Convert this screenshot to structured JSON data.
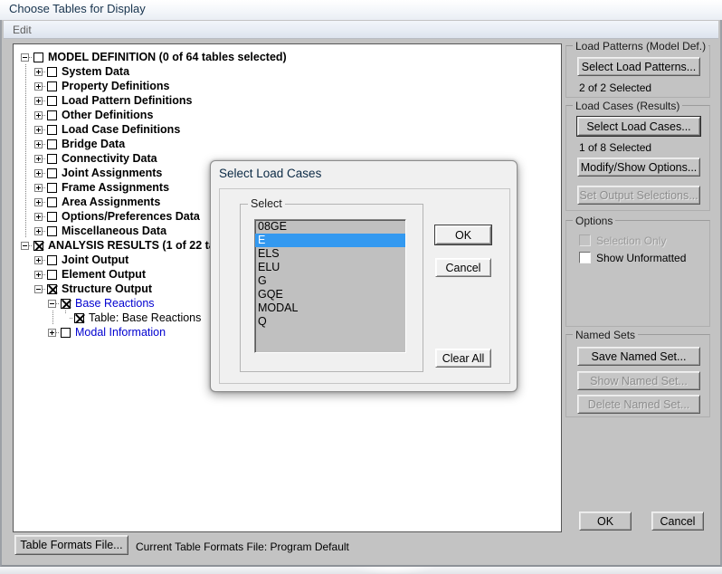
{
  "window": {
    "title": "Choose Tables for Display",
    "menu": [
      "Edit"
    ]
  },
  "tree": {
    "nodes": [
      {
        "label": "MODEL DEFINITION  (0 of 64 tables selected)",
        "depth": 0,
        "expander": "minus",
        "checked": false,
        "bold": true,
        "blue": false
      },
      {
        "label": "System Data",
        "depth": 1,
        "expander": "plus",
        "checked": false,
        "bold": true,
        "blue": false
      },
      {
        "label": "Property Definitions",
        "depth": 1,
        "expander": "plus",
        "checked": false,
        "bold": true,
        "blue": false
      },
      {
        "label": "Load Pattern Definitions",
        "depth": 1,
        "expander": "plus",
        "checked": false,
        "bold": true,
        "blue": false
      },
      {
        "label": "Other Definitions",
        "depth": 1,
        "expander": "plus",
        "checked": false,
        "bold": true,
        "blue": false
      },
      {
        "label": "Load Case Definitions",
        "depth": 1,
        "expander": "plus",
        "checked": false,
        "bold": true,
        "blue": false
      },
      {
        "label": "Bridge Data",
        "depth": 1,
        "expander": "plus",
        "checked": false,
        "bold": true,
        "blue": false
      },
      {
        "label": "Connectivity Data",
        "depth": 1,
        "expander": "plus",
        "checked": false,
        "bold": true,
        "blue": false
      },
      {
        "label": "Joint Assignments",
        "depth": 1,
        "expander": "plus",
        "checked": false,
        "bold": true,
        "blue": false
      },
      {
        "label": "Frame Assignments",
        "depth": 1,
        "expander": "plus",
        "checked": false,
        "bold": true,
        "blue": false
      },
      {
        "label": "Area Assignments",
        "depth": 1,
        "expander": "plus",
        "checked": false,
        "bold": true,
        "blue": false
      },
      {
        "label": "Options/Preferences Data",
        "depth": 1,
        "expander": "plus",
        "checked": false,
        "bold": true,
        "blue": false
      },
      {
        "label": "Miscellaneous Data",
        "depth": 1,
        "expander": "plus",
        "checked": false,
        "bold": true,
        "blue": false
      },
      {
        "label": "ANALYSIS RESULTS  (1 of 22 ta",
        "depth": 0,
        "expander": "minus",
        "checked": true,
        "bold": true,
        "blue": false
      },
      {
        "label": "Joint Output",
        "depth": 1,
        "expander": "plus",
        "checked": false,
        "bold": true,
        "blue": false
      },
      {
        "label": "Element Output",
        "depth": 1,
        "expander": "plus",
        "checked": false,
        "bold": true,
        "blue": false
      },
      {
        "label": "Structure Output",
        "depth": 1,
        "expander": "minus",
        "checked": true,
        "bold": true,
        "blue": false
      },
      {
        "label": "Base Reactions",
        "depth": 2,
        "expander": "minus",
        "checked": true,
        "bold": false,
        "blue": true
      },
      {
        "label": "Table:  Base Reactions",
        "depth": 3,
        "expander": "none",
        "checked": true,
        "bold": false,
        "blue": false
      },
      {
        "label": "Modal Information",
        "depth": 2,
        "expander": "plus",
        "checked": false,
        "bold": false,
        "blue": true
      }
    ]
  },
  "load_patterns_group": {
    "title": "Load Patterns (Model Def.)",
    "select_button": "Select Load Patterns...",
    "status": "2 of 2 Selected"
  },
  "load_cases_group": {
    "title": "Load Cases (Results)",
    "select_button": "Select Load Cases...",
    "status": "1 of 8 Selected",
    "modify_button": "Modify/Show Options...",
    "set_output_button": "Set Output Selections..."
  },
  "options_group": {
    "title": "Options",
    "selection_only_label": "Selection Only",
    "selection_only_checked": false,
    "show_unformatted_label": "Show Unformatted",
    "show_unformatted_checked": false
  },
  "named_sets_group": {
    "title": "Named Sets",
    "save_button": "Save Named Set...",
    "show_button": "Show Named Set...",
    "delete_button": "Delete Named Set..."
  },
  "footer": {
    "ok_button": "OK",
    "cancel_button": "Cancel",
    "table_formats_button": "Table Formats File...",
    "status_text": "Current Table Formats File:  Program Default"
  },
  "dialog": {
    "title": "Select Load Cases",
    "group_title": "Select",
    "items": [
      "08GE",
      "E",
      "ELS",
      "ELU",
      "G",
      "GQE",
      "MODAL",
      "Q"
    ],
    "selected_index": 1,
    "ok_button": "OK",
    "cancel_button": "Cancel",
    "clear_all_button": "Clear All"
  },
  "colors": {
    "selection_blue": "#3399f0",
    "tree_link_blue": "#0000d0",
    "window_face": "#c3c3c3",
    "dialog_face": "#f0f0f0"
  }
}
